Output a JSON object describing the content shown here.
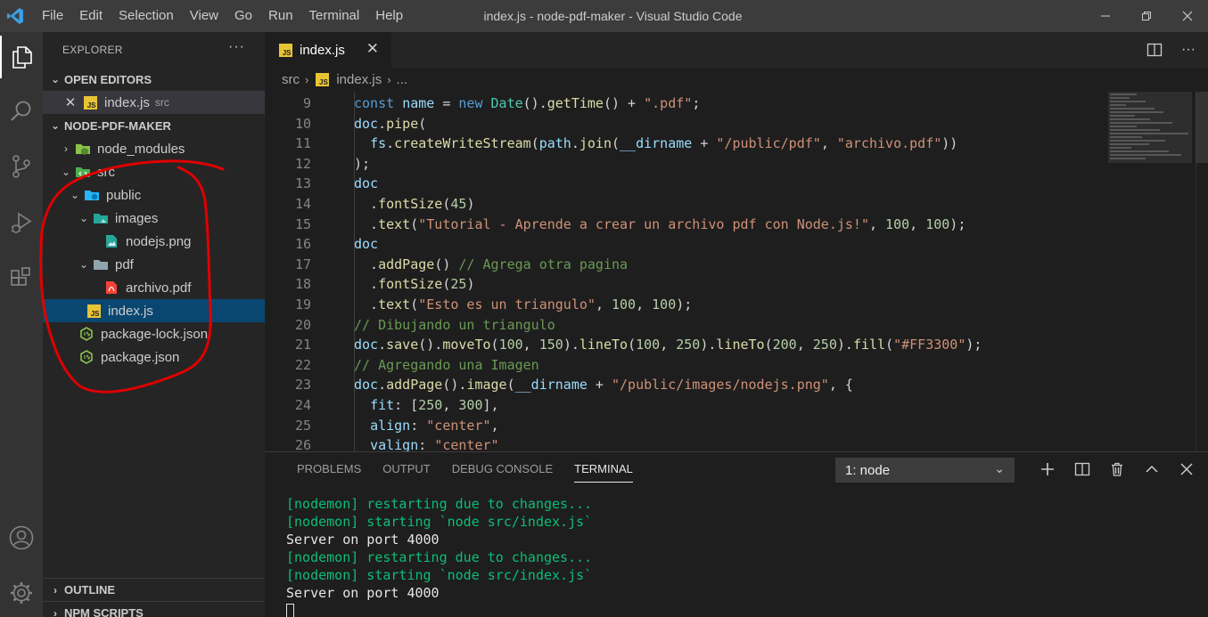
{
  "window": {
    "title": "index.js - node-pdf-maker - Visual Studio Code",
    "menu": [
      "File",
      "Edit",
      "Selection",
      "View",
      "Go",
      "Run",
      "Terminal",
      "Help"
    ]
  },
  "activity_bar": [
    "files-icon",
    "search-icon",
    "source-control-icon",
    "run-debug-icon",
    "extensions-icon",
    "account-icon",
    "settings-gear-icon"
  ],
  "sidebar": {
    "title": "EXPLORER",
    "more": "···",
    "open_editors": {
      "label": "OPEN EDITORS",
      "items": [
        {
          "name": "index.js",
          "desc": "src"
        }
      ]
    },
    "project": {
      "label": "NODE-PDF-MAKER",
      "items": [
        {
          "name": "node_modules"
        },
        {
          "name": "src"
        },
        {
          "name": "public"
        },
        {
          "name": "images"
        },
        {
          "name": "nodejs.png"
        },
        {
          "name": "pdf"
        },
        {
          "name": "archivo.pdf"
        },
        {
          "name": "index.js"
        },
        {
          "name": "package-lock.json"
        },
        {
          "name": "package.json"
        }
      ]
    },
    "outline": "OUTLINE",
    "npm_scripts": "NPM SCRIPTS"
  },
  "editor": {
    "tab": "index.js",
    "breadcrumb": [
      "src",
      "index.js",
      "..."
    ],
    "lines": [
      {
        "n": "9",
        "text": "const name = new Date().getTime() + \".pdf\";"
      },
      {
        "n": "10",
        "text": "doc.pipe("
      },
      {
        "n": "11",
        "text": "  fs.createWriteStream(path.join(__dirname + \"/public/pdf\", \"archivo.pdf\"))"
      },
      {
        "n": "12",
        "text": ");"
      },
      {
        "n": "13",
        "text": "doc"
      },
      {
        "n": "14",
        "text": "  .fontSize(45)"
      },
      {
        "n": "15",
        "text": "  .text(\"Tutorial - Aprende a crear un archivo pdf con Node.js!\", 100, 100);"
      },
      {
        "n": "16",
        "text": "doc"
      },
      {
        "n": "17",
        "text": "  .addPage() // Agrega otra pagina"
      },
      {
        "n": "18",
        "text": "  .fontSize(25)"
      },
      {
        "n": "19",
        "text": "  .text(\"Esto es un triangulo\", 100, 100);"
      },
      {
        "n": "20",
        "text": "// Dibujando un triangulo"
      },
      {
        "n": "21",
        "text": "doc.save().moveTo(100, 150).lineTo(100, 250).lineTo(200, 250).fill(\"#FF3300\");"
      },
      {
        "n": "22",
        "text": "// Agregando una Imagen"
      },
      {
        "n": "23",
        "text": "doc.addPage().image(__dirname + \"/public/images/nodejs.png\", {"
      },
      {
        "n": "24",
        "text": "  fit: [250, 300],"
      },
      {
        "n": "25",
        "text": "  align: \"center\","
      },
      {
        "n": "26",
        "text": "  valign: \"center\""
      }
    ]
  },
  "panel": {
    "tabs": [
      "PROBLEMS",
      "OUTPUT",
      "DEBUG CONSOLE",
      "TERMINAL"
    ],
    "active_tab": "TERMINAL",
    "terminal_select": "1: node",
    "terminal_lines": [
      {
        "text": "[nodemon] restarting due to changes...",
        "color": "green"
      },
      {
        "text": "[nodemon] starting `node src/index.js`",
        "color": "green"
      },
      {
        "text": "Server on port 4000",
        "color": "white"
      },
      {
        "text": "[nodemon] restarting due to changes...",
        "color": "green"
      },
      {
        "text": "[nodemon] starting `node src/index.js`",
        "color": "green"
      },
      {
        "text": "Server on port 4000",
        "color": "white"
      }
    ]
  },
  "colors": {
    "accent_selection": "#094771",
    "js_badge": "#e8c435",
    "annotation": "#e00000",
    "terminal_green": "#0dbc79"
  }
}
